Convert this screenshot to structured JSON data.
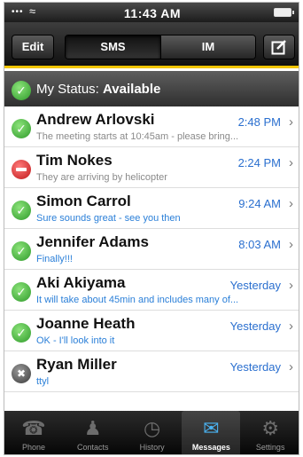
{
  "status_bar": {
    "signal": "•••",
    "time": "11:43 AM"
  },
  "nav": {
    "edit_label": "Edit",
    "segments": [
      {
        "label": "SMS",
        "active": true
      },
      {
        "label": "IM",
        "active": false
      }
    ],
    "compose_icon": "compose-icon"
  },
  "my_status": {
    "prefix": "My Status:",
    "value": "Available"
  },
  "conversations": [
    {
      "name": "Andrew Arlovski",
      "time": "2:48 PM",
      "message": "The meeting starts at 10:45am - please bring...",
      "status": "available",
      "unread": false
    },
    {
      "name": "Tim Nokes",
      "time": "2:24 PM",
      "message": "They are arriving by helicopter",
      "status": "busy",
      "unread": false
    },
    {
      "name": "Simon Carrol",
      "time": "9:24 AM",
      "message": "Sure sounds great - see you then",
      "status": "available",
      "unread": true
    },
    {
      "name": "Jennifer Adams",
      "time": "8:03 AM",
      "message": "Finally!!!",
      "status": "available",
      "unread": true
    },
    {
      "name": "Aki Akiyama",
      "time": "Yesterday",
      "message": "It will take about 45min and includes many of...",
      "status": "available",
      "unread": true
    },
    {
      "name": "Joanne Heath",
      "time": "Yesterday",
      "message": "OK - I'll look into it",
      "status": "available",
      "unread": true
    },
    {
      "name": "Ryan Miller",
      "time": "Yesterday",
      "message": "ttyl",
      "status": "offline",
      "unread": true
    }
  ],
  "tabs": [
    {
      "label": "Phone",
      "icon": "phone-icon",
      "glyph": "☎",
      "active": false
    },
    {
      "label": "Contacts",
      "icon": "contacts-icon",
      "glyph": "♟",
      "active": false
    },
    {
      "label": "History",
      "icon": "clock-icon",
      "glyph": "◷",
      "active": false
    },
    {
      "label": "Messages",
      "icon": "messages-icon",
      "glyph": "✉",
      "active": true
    },
    {
      "label": "Settings",
      "icon": "gear-icon",
      "glyph": "⚙",
      "active": false
    }
  ],
  "colors": {
    "accent_yellow": "#f2c500",
    "link_blue": "#2a6fcf",
    "available_green": "#2e9a2a",
    "busy_red": "#c0181a"
  }
}
